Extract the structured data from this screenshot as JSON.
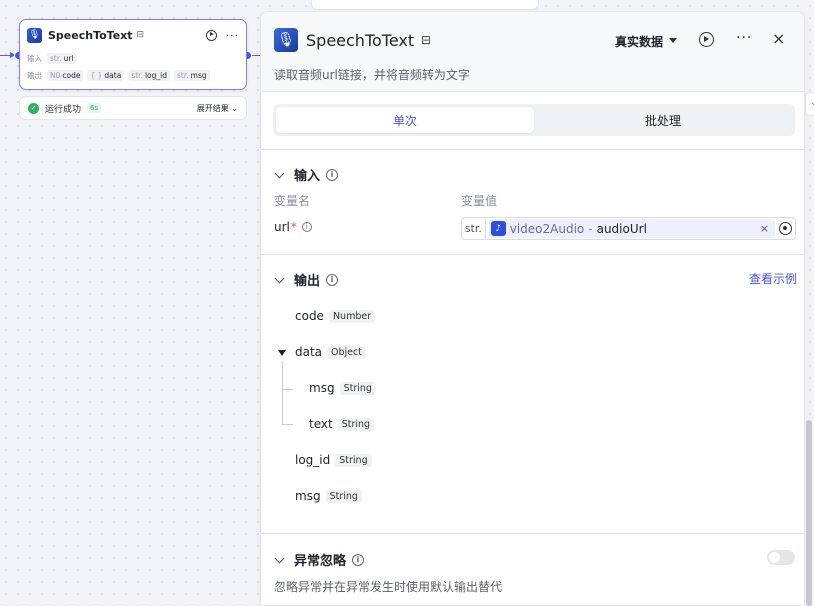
{
  "node": {
    "title": "SpeechToText",
    "store_icon": "store-icon",
    "more": "···",
    "input_label": "输入",
    "output_label": "输出",
    "inputs": [
      {
        "type": "str.",
        "name": "url"
      }
    ],
    "outputs": [
      {
        "type": "N0",
        "name": "code"
      },
      {
        "type": "{ }",
        "name": "data"
      },
      {
        "type": "str.",
        "name": "log_id"
      },
      {
        "type": "str.",
        "name": "msg"
      }
    ]
  },
  "run_status": {
    "text": "运行成功",
    "time": "6s",
    "expand": "展开结果"
  },
  "panel": {
    "title": "SpeechToText",
    "mode": "真实数据",
    "more": "···",
    "close": "×",
    "description": "读取音频url链接，并将音频转为文字",
    "tabs": [
      {
        "label": "单次",
        "active": true
      },
      {
        "label": "批处理",
        "active": false
      }
    ],
    "input_section": {
      "title": "输入",
      "col_name": "变量名",
      "col_value": "变量值",
      "var_name": "url",
      "required_mark": "*",
      "ref_type": "str.",
      "ref_node": "video2Audio",
      "ref_sep": "-",
      "ref_var": "audioUrl",
      "clear": "×"
    },
    "output_section": {
      "title": "输出",
      "view_example": "查看示例",
      "fields": [
        {
          "name": "code",
          "type": "Number"
        },
        {
          "name": "data",
          "type": "Object"
        },
        {
          "name": "msg",
          "type": "String"
        },
        {
          "name": "text",
          "type": "String"
        },
        {
          "name": "log_id",
          "type": "String"
        },
        {
          "name": "msg",
          "type": "String"
        }
      ]
    },
    "ignore_section": {
      "title": "异常忽略",
      "enabled": false,
      "description": "忽略异常并在异常发生时使用默认输出替代"
    }
  },
  "colors": {
    "accent": "#4d53e8",
    "success": "#2fb35a",
    "required": "#e5484d"
  }
}
